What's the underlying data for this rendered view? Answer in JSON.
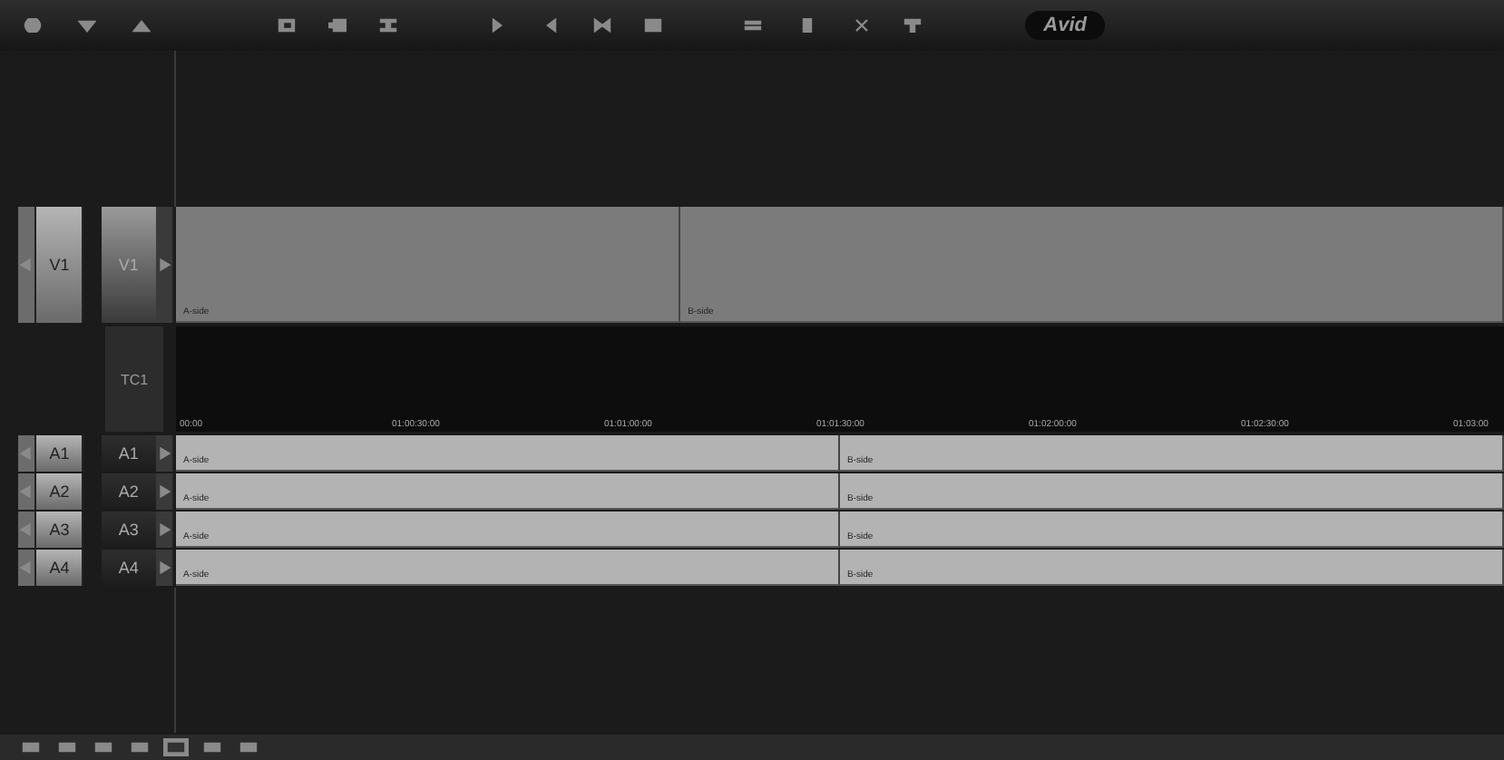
{
  "toolbar": {
    "logo": "Avid"
  },
  "video_tracks": [
    {
      "record": "V1",
      "source": "V1",
      "clips": [
        {
          "label": "A-side"
        },
        {
          "label": "B-side"
        }
      ]
    }
  ],
  "timecode_track": {
    "label": "TC1",
    "ticks": [
      "00:00",
      "01:00:30:00",
      "01:01:00:00",
      "01:01:30:00",
      "01:02:00:00",
      "01:02:30:00",
      "01:03:00"
    ]
  },
  "audio_tracks": [
    {
      "record": "A1",
      "source": "A1",
      "clips": [
        {
          "label": "A-side"
        },
        {
          "label": "B-side"
        }
      ]
    },
    {
      "record": "A2",
      "source": "A2",
      "clips": [
        {
          "label": "A-side"
        },
        {
          "label": "B-side"
        }
      ]
    },
    {
      "record": "A3",
      "source": "A3",
      "clips": [
        {
          "label": "A-side"
        },
        {
          "label": "B-side"
        }
      ]
    },
    {
      "record": "A4",
      "source": "A4",
      "clips": [
        {
          "label": "A-side"
        },
        {
          "label": "B-side"
        }
      ]
    }
  ]
}
